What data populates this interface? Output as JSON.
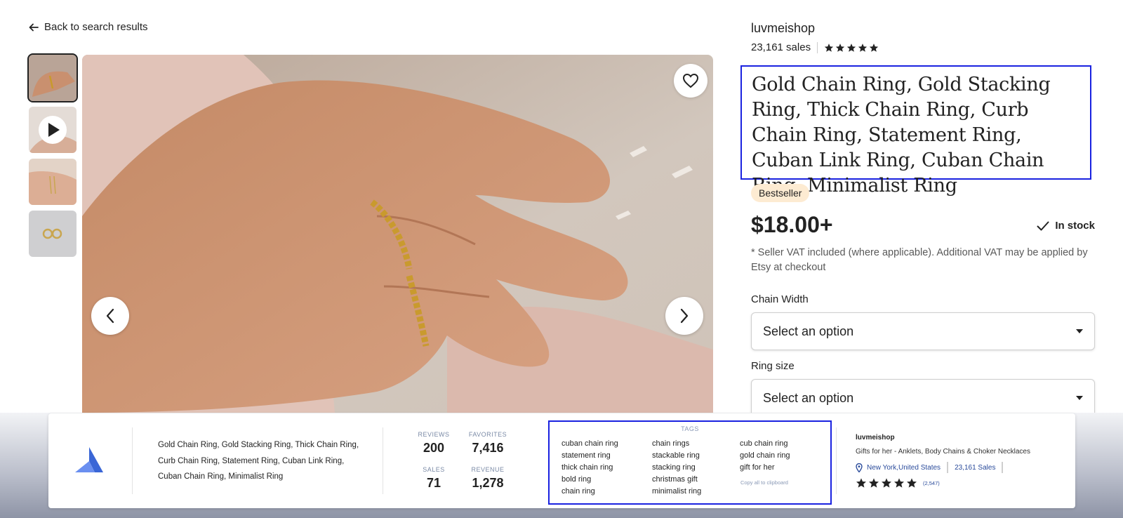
{
  "nav": {
    "back_label": "Back to search results"
  },
  "gallery": {
    "thumbnails": [
      "ring-on-hand-thumbnail",
      "video-thumbnail",
      "ring-stack-thumbnail",
      "rings-on-fabric-thumbnail"
    ]
  },
  "product": {
    "shop_name": "luvmeishop",
    "sales": "23,161 sales",
    "rating_stars": 5,
    "title": "Gold Chain Ring, Gold Stacking Ring, Thick Chain Ring, Curb Chain Ring, Statement Ring, Cuban Link Ring, Cuban Chain Ring, Minimalist Ring",
    "badge": "Bestseller",
    "price": "$18.00+",
    "stock": "In stock",
    "vat_note": "* Seller VAT included (where applicable). Additional VAT may be applied by Etsy at checkout",
    "options": [
      {
        "label": "Chain Width",
        "value": "Select an option"
      },
      {
        "label": "Ring size",
        "value": "Select an option"
      }
    ]
  },
  "panel": {
    "title": "Gold Chain Ring, Gold Stacking Ring, Thick Chain Ring, Curb Chain Ring, Statement Ring, Cuban Link Ring, Cuban Chain Ring, Minimalist Ring",
    "stats": {
      "reviews_label": "REVIEWS",
      "reviews": "200",
      "favorites_label": "FAVORITES",
      "favorites": "7,416",
      "sales_label": "SALES",
      "sales": "71",
      "revenue_label": "REVENUE",
      "revenue": "1,278"
    },
    "tags_label": "TAGS",
    "tags_col1": [
      "cuban chain ring",
      "statement ring",
      "thick chain ring",
      "bold ring",
      "chain ring"
    ],
    "tags_col2": [
      "chain rings",
      "stackable ring",
      "stacking ring",
      "christmas gift",
      "minimalist ring"
    ],
    "tags_col3": [
      "cub chain ring",
      "gold chain ring",
      "gift for her"
    ],
    "copy_all": "Copy all to clipboard",
    "shop": {
      "name": "luvmeishop",
      "description": "Gifts for her - Anklets, Body Chains & Choker Necklaces",
      "location": "New York,United States",
      "sales": "23,161 Sales",
      "rating_count": "(2,547)"
    }
  },
  "colors": {
    "highlight": "#1a22e0",
    "badge_bg": "#fdebd2",
    "link": "#2a4b9b"
  }
}
